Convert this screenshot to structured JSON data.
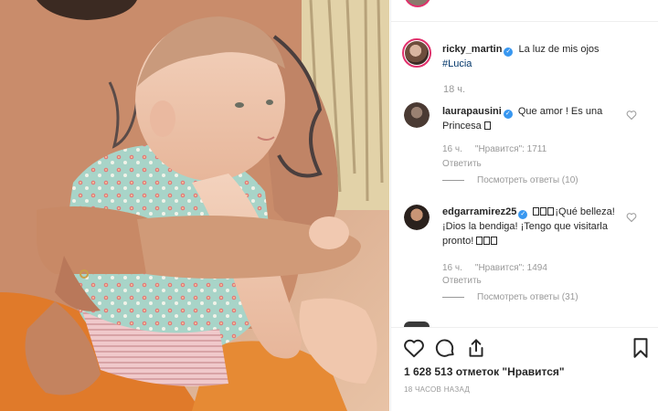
{
  "post": {
    "author": "ricky_martin",
    "caption": "La luz de mis ojos",
    "hashtag": "#Lucia",
    "time": "18 ч."
  },
  "comments": [
    {
      "username": "laurapausini",
      "text": "Que amor ! Es una Princesa",
      "time": "16 ч.",
      "likes": "\"Нравится\": 1711",
      "reply_label": "Ответить",
      "view_replies": "Посмотреть ответы (10)"
    },
    {
      "username": "edgarramirez25",
      "text_before": "¡Qué belleza! ¡Dios la bendiga! ¡Tengo que visitarla pronto!",
      "time": "16 ч.",
      "likes": "\"Нравится\": 1494",
      "reply_label": "Ответить",
      "view_replies": "Посмотреть ответы (31)"
    }
  ],
  "footer": {
    "likes_count": "1 628 513 отметок \"Нравится\"",
    "time_ago": "18 часов назад"
  },
  "icons": {
    "like": "heart-icon",
    "comment": "comment-icon",
    "share": "share-icon",
    "save": "bookmark-icon",
    "verified": "verified-badge-icon"
  },
  "colors": {
    "accent_blue": "#3897f0",
    "ring": "#e1306c",
    "muted": "#999999",
    "text": "#262626"
  }
}
